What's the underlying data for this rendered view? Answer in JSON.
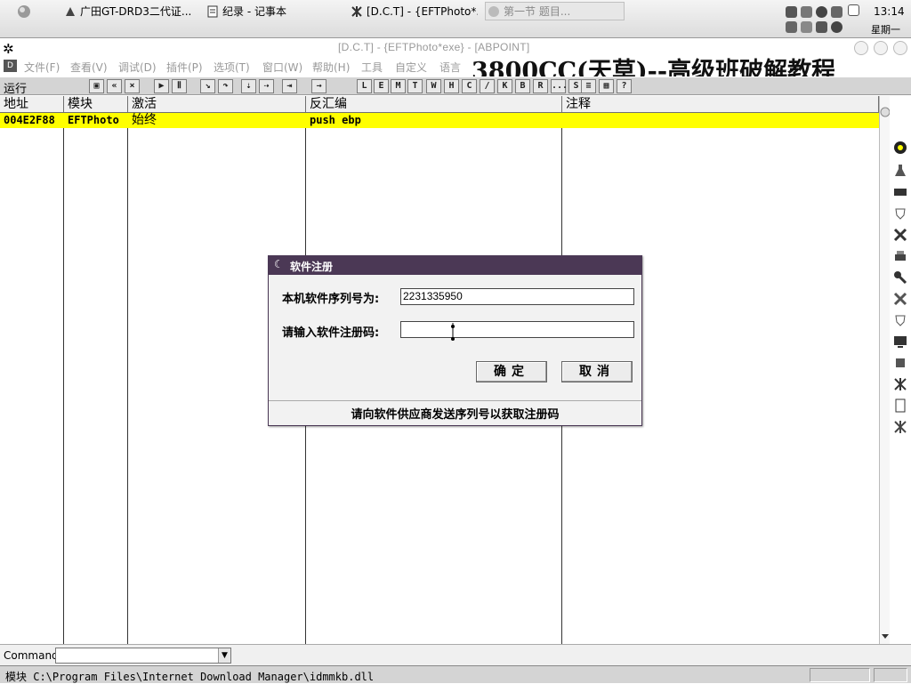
{
  "taskbar": {
    "tasks": [
      {
        "label": "广田GT-DRD3二代证..."
      },
      {
        "label": "纪录 - 记事本"
      },
      {
        "label": "[D.C.T] - {EFTPhoto*..."
      },
      {
        "label": "第一节 题目..."
      }
    ],
    "clock": "13:14",
    "weekday": "星期一"
  },
  "window": {
    "title": "[D.C.T] - {EFTPhoto*exe} - [ABPOINT]"
  },
  "menu": {
    "items": [
      "文件(F)",
      "查看(V)",
      "调试(D)",
      "插件(P)",
      "选项(T)",
      "窗口(W)",
      "帮助(H)",
      "工具",
      "自定义",
      "语言"
    ],
    "banner": "3800CC(天草)--高级班破解教程"
  },
  "toolbar": {
    "run_label": "运行",
    "letter_buttons": [
      "L",
      "E",
      "M",
      "T",
      "W",
      "H",
      "C",
      "/",
      "K",
      "B",
      "R",
      "...",
      "S"
    ]
  },
  "grid": {
    "headers": [
      "地址",
      "模块",
      "激活",
      "反汇编",
      "注释"
    ],
    "rows": [
      {
        "address": "004E2F88",
        "module": "EFTPhoto",
        "active": "始终",
        "disasm": "push ebp",
        "comment": ""
      }
    ]
  },
  "command": {
    "label": "Command",
    "value": ""
  },
  "status": {
    "text": "模块 C:\\Program Files\\Internet Download Manager\\idmmkb.dll"
  },
  "dialog": {
    "title": "软件注册",
    "serial_label": "本机软件序列号为:",
    "serial_value": "2231335950",
    "code_label": "请输入软件注册码:",
    "code_value": "",
    "ok_label": "确定",
    "cancel_label": "取消",
    "hint": "请向软件供应商发送序列号以获取注册码"
  },
  "colors": {
    "highlight_row": "#ffff00",
    "dialog_titlebar": "#4b3855"
  }
}
